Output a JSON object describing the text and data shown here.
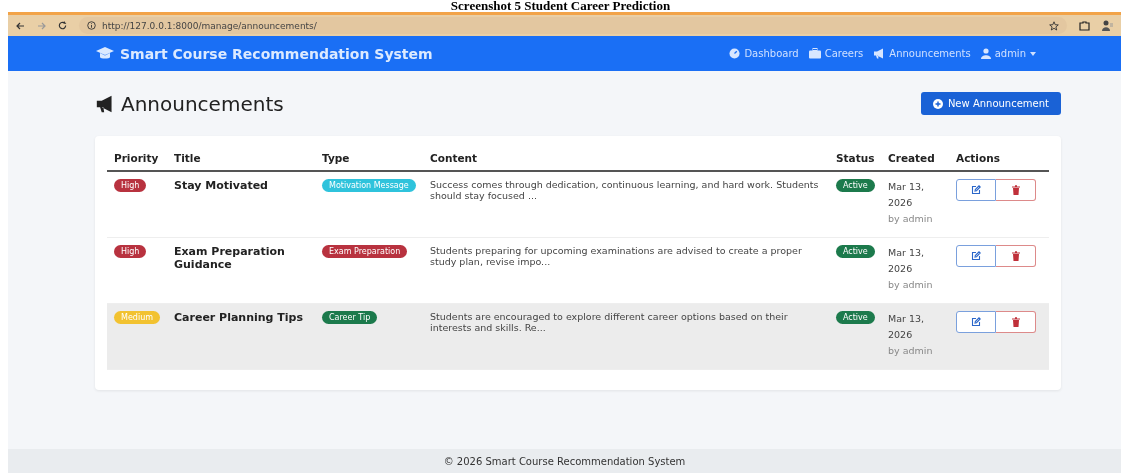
{
  "caption": "Screenshot 5 Student Career Prediction",
  "browser": {
    "url": "http://127.0.0.1:8000/manage/announcements/"
  },
  "navbar": {
    "brand": "Smart Course Recommendation System",
    "links": [
      {
        "label": "Dashboard"
      },
      {
        "label": "Careers"
      },
      {
        "label": "Announcements"
      },
      {
        "label": "admin"
      }
    ]
  },
  "page": {
    "title": "Announcements",
    "new_button": "New Announcement"
  },
  "table": {
    "columns": [
      "Priority",
      "Title",
      "Type",
      "Content",
      "Status",
      "Created",
      "Actions"
    ],
    "rows": [
      {
        "priority": {
          "label": "High",
          "color": "#b8323f"
        },
        "title": "Stay Motivated",
        "type": {
          "label": "Motivation Message",
          "color": "#2fc3dc"
        },
        "content": "Success comes through dedication, continuous learning, and hard work. Students should stay focused ...",
        "status": "Active",
        "date": "Mar 13, 2026",
        "author": "by admin",
        "highlighted": false
      },
      {
        "priority": {
          "label": "High",
          "color": "#b8323f"
        },
        "title": "Exam Preparation Guidance",
        "type": {
          "label": "Exam Preparation",
          "color": "#b8323f"
        },
        "content": "Students preparing for upcoming examinations are advised to create a proper study plan, revise impo...",
        "status": "Active",
        "date": "Mar 13, 2026",
        "author": "by admin",
        "highlighted": false
      },
      {
        "priority": {
          "label": "Medium",
          "color": "#f2c230"
        },
        "title": "Career Planning Tips",
        "type": {
          "label": "Career Tip",
          "color": "#1c7a4c"
        },
        "content": "Students are encouraged to explore different career options based on their interests and skills. Re...",
        "status": "Active",
        "date": "Mar 13, 2026",
        "author": "by admin",
        "highlighted": true
      }
    ]
  },
  "footer": "© 2026 Smart Course Recommendation System"
}
